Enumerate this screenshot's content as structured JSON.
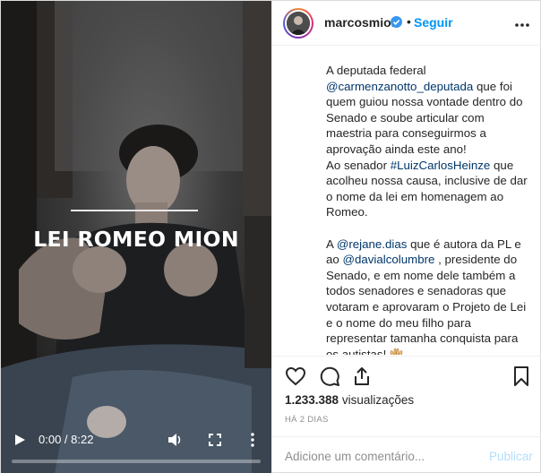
{
  "video": {
    "overlay_title": "LEI ROMEO MION",
    "time_display": "0:00 / 8:22",
    "progress": 0.0
  },
  "header": {
    "username": "marcosmion",
    "separator": "•",
    "follow_label": "Seguir",
    "verified_icon": "verified-badge-icon",
    "options_icon": "more-options-icon"
  },
  "caption": {
    "p1_a": "A deputada federal ",
    "p1_mention1": "@carmenzanotto_deputada",
    "p1_b": " que foi quem guiou nossa vontade dentro do Senado e soube articular com maestria para conseguirmos a aprovação ainda este ano!",
    "p1_c": "Ao senador ",
    "p1_hashtag": "#LuizCarlosHeinze",
    "p1_d": " que acolheu nossa causa, inclusive de dar o nome da lei em homenagem ao Romeo.",
    "p2_a": "A ",
    "p2_mention1": "@rejane.dias",
    "p2_b": " que é autora da PL e ao ",
    "p2_mention2": "@davialcolumbre",
    "p2_c": " , presidente do Senado, e em nome dele também a todos senadores e senadoras que votaram e aprovaram o Projeto de Lei e o nome do meu filho para representar tamanha conquista para os autistas! ",
    "p2_emoji": "raised-hands-emoji",
    "p3": "."
  },
  "actions": {
    "like_icon": "heart-icon",
    "comment_icon": "comment-icon",
    "share_icon": "share-icon",
    "save_icon": "bookmark-icon"
  },
  "stats": {
    "views_count": "1.233.388",
    "views_label": "visualizações",
    "time_ago": "HÁ 2 DIAS"
  },
  "comment": {
    "placeholder": "Adicione um comentário...",
    "publish_label": "Publicar"
  },
  "colors": {
    "accent": "#0095f6",
    "link": "#00376b",
    "muted": "#8e8e8e",
    "publish_disabled": "#b2dffc"
  }
}
